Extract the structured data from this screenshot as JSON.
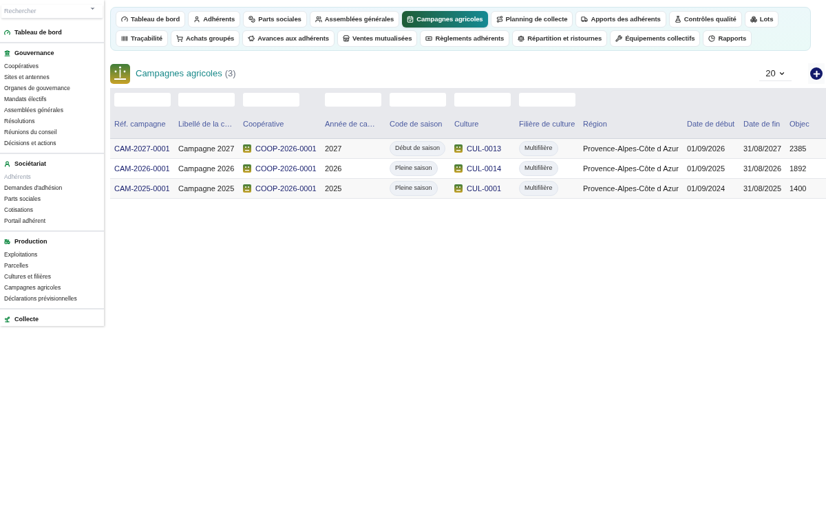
{
  "sidebar": {
    "search": {
      "placeholder": "Rechercher"
    },
    "sections": [
      {
        "title": "Tableau de bord"
      },
      {
        "title": "Gouvernance",
        "items": [
          {
            "label": "Coopératives",
            "disabled": false
          },
          {
            "label": "Sites et antennes",
            "disabled": false
          },
          {
            "label": "Organes de gouvernance",
            "disabled": false
          },
          {
            "label": "Mandats électifs",
            "disabled": false
          },
          {
            "label": "Assemblées générales",
            "disabled": false
          },
          {
            "label": "Résolutions",
            "disabled": false
          },
          {
            "label": "Réunions du conseil",
            "disabled": false
          },
          {
            "label": "Décisions et actions",
            "disabled": false
          }
        ]
      },
      {
        "title": "Sociétariat",
        "items": [
          {
            "label": "Adhérents",
            "disabled": true
          },
          {
            "label": "Demandes d'adhésion",
            "disabled": false
          },
          {
            "label": "Parts sociales",
            "disabled": false
          },
          {
            "label": "Cotisations",
            "disabled": false
          },
          {
            "label": "Portail adhérent",
            "disabled": false
          }
        ]
      },
      {
        "title": "Production",
        "items": [
          {
            "label": "Exploitations",
            "disabled": false
          },
          {
            "label": "Parcelles",
            "disabled": false
          },
          {
            "label": "Cultures et filières",
            "disabled": false
          },
          {
            "label": "Campagnes agricoles",
            "disabled": false
          },
          {
            "label": "Déclarations prévisionnelles",
            "disabled": false
          }
        ]
      },
      {
        "title": "Collecte"
      }
    ]
  },
  "tabs": [
    {
      "label": "Tableau de bord",
      "selected": false
    },
    {
      "label": "Adhérents",
      "selected": false
    },
    {
      "label": "Parts sociales",
      "selected": false
    },
    {
      "label": "Assemblées générales",
      "selected": false
    },
    {
      "label": "Campagnes agricoles",
      "selected": true
    },
    {
      "label": "Planning de collecte",
      "selected": false
    },
    {
      "label": "Apports des adhérents",
      "selected": false
    },
    {
      "label": "Contrôles qualité",
      "selected": false
    },
    {
      "label": "Lots",
      "selected": false
    },
    {
      "label": "Traçabilité",
      "selected": false
    },
    {
      "label": "Achats groupés",
      "selected": false
    },
    {
      "label": "Avances aux adhérents",
      "selected": false
    },
    {
      "label": "Ventes mutualisées",
      "selected": false
    },
    {
      "label": "Règlements adhérents",
      "selected": false
    },
    {
      "label": "Répartition et ristournes",
      "selected": false
    },
    {
      "label": "Équipements collectifs",
      "selected": false
    },
    {
      "label": "Rapports",
      "selected": false
    }
  ],
  "header": {
    "title": "Campagnes agricoles",
    "count": "(3)",
    "page_size": "20"
  },
  "table": {
    "columns": [
      {
        "label": "Réf. campagne",
        "filter": true
      },
      {
        "label": "Libellé de la c…",
        "filter": true
      },
      {
        "label": "Coopérative",
        "filter": true
      },
      {
        "label": "Année de ca…",
        "filter": true
      },
      {
        "label": "Code de saison",
        "filter": true
      },
      {
        "label": "Culture",
        "filter": true
      },
      {
        "label": "Filière de culture",
        "filter": true
      },
      {
        "label": "Région",
        "filter": false
      },
      {
        "label": "Date de début",
        "filter": false
      },
      {
        "label": "Date de fin",
        "filter": false
      },
      {
        "label": "Objec",
        "filter": false
      }
    ],
    "rows": [
      {
        "ref": "CAM-2027-0001",
        "label": "Campagne 2027",
        "coop": "COOP-2026-0001",
        "year": "2027",
        "season": "Début de saison",
        "culture": "CUL-0013",
        "filiere": "Multifilière",
        "region": "Provence-Alpes-Côte d Azur",
        "start": "01/09/2026",
        "end": "31/08/2027",
        "objective": "2385"
      },
      {
        "ref": "CAM-2026-0001",
        "label": "Campagne 2026",
        "coop": "COOP-2026-0001",
        "year": "2026",
        "season": "Pleine saison",
        "culture": "CUL-0014",
        "filiere": "Multifilière",
        "region": "Provence-Alpes-Côte d Azur",
        "start": "01/09/2025",
        "end": "31/08/2026",
        "objective": "1892"
      },
      {
        "ref": "CAM-2025-0001",
        "label": "Campagne 2025",
        "coop": "COOP-2026-0001",
        "year": "2025",
        "season": "Pleine saison",
        "culture": "CUL-0001",
        "filiere": "Multifilière",
        "region": "Provence-Alpes-Côte d Azur",
        "start": "01/09/2024",
        "end": "31/08/2025",
        "objective": "1400"
      }
    ]
  }
}
